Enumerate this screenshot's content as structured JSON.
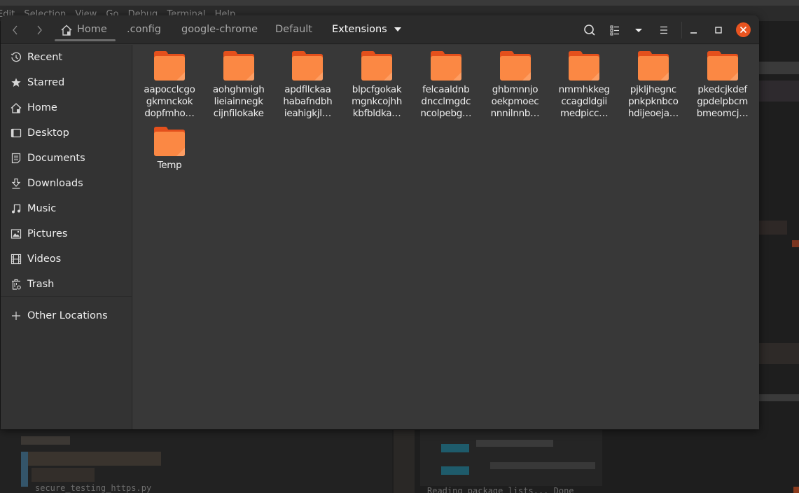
{
  "background_app": {
    "menu_items": [
      "Edit",
      "Selection",
      "View",
      "Go",
      "Debug",
      "Terminal",
      "Help"
    ],
    "bottom_left_text": "secure_testing_https.py",
    "bottom_right_text": "Reading package lists... Done"
  },
  "window": {
    "nav": {
      "back_icon": "chevron-left-icon",
      "forward_icon": "chevron-right-icon"
    },
    "breadcrumbs": [
      {
        "label": "Home",
        "icon": "home-icon"
      },
      {
        "label": ".config"
      },
      {
        "label": "google-chrome"
      },
      {
        "label": "Default"
      },
      {
        "label": "Extensions",
        "active": true
      }
    ],
    "toolbar": {
      "search_icon": "search-icon",
      "view_list_icon": "list-view-icon",
      "view_options_icon": "chevron-down-icon",
      "menu_icon": "hamburger-menu-icon",
      "minimize_icon": "minimize-icon",
      "maximize_icon": "maximize-icon",
      "close_icon": "close-icon"
    },
    "accent_color": "#e95420"
  },
  "sidebar": {
    "items": [
      {
        "label": "Recent",
        "icon": "clock-icon"
      },
      {
        "label": "Starred",
        "icon": "star-icon"
      },
      {
        "label": "Home",
        "icon": "home-icon"
      },
      {
        "label": "Desktop",
        "icon": "desktop-icon"
      },
      {
        "label": "Documents",
        "icon": "document-icon"
      },
      {
        "label": "Downloads",
        "icon": "download-icon"
      },
      {
        "label": "Music",
        "icon": "music-icon"
      },
      {
        "label": "Pictures",
        "icon": "picture-icon"
      },
      {
        "label": "Videos",
        "icon": "video-icon"
      },
      {
        "label": "Trash",
        "icon": "trash-icon"
      }
    ],
    "other_locations": {
      "label": "Other Locations",
      "icon": "plus-icon"
    }
  },
  "content": {
    "folders": [
      {
        "label": "aapocclcgo\ngkmnckok\ndopfmho…"
      },
      {
        "label": "aohghmigh\nlieiainnegk\ncijnfilokake"
      },
      {
        "label": "apdfllckaa\nhabafndbh\nieahigkjl…"
      },
      {
        "label": "blpcfgokak\nmgnkcojhh\nkbfbldka…"
      },
      {
        "label": "felcaaldnb\ndncclmgdc\nncolpebg…"
      },
      {
        "label": "ghbmnnjo\noekpmoec\nnnnilnnb…"
      },
      {
        "label": "nmmhkkeg\nccagdldgii\nmedpicc…"
      },
      {
        "label": "pjkljhegnc\npnkpknbco\nhdijeoeja…"
      },
      {
        "label": "pkedcjkdef\ngpdelpbcm\nbmeomcj…"
      },
      {
        "label": "Temp"
      }
    ],
    "folder_color": "#f97d3c"
  }
}
